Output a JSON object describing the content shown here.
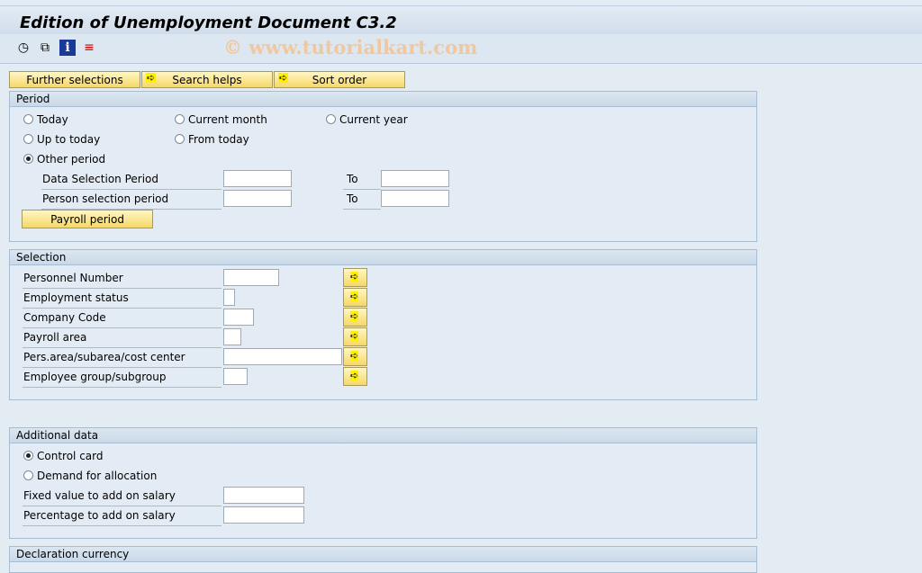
{
  "title": "Edition of Unemployment Document C3.2",
  "watermark": "© www.tutorialkart.com",
  "toolbar": {
    "icons": [
      "execute-clock-icon",
      "copy-icon",
      "info-icon",
      "selection-options-icon"
    ]
  },
  "buttons": {
    "further": "Further selections",
    "search": "Search helps",
    "sort": "Sort order"
  },
  "period": {
    "header": "Period",
    "radios": [
      {
        "label": "Today",
        "checked": false
      },
      {
        "label": "Current month",
        "checked": false
      },
      {
        "label": "Current year",
        "checked": false
      },
      {
        "label": "Up to today",
        "checked": false
      },
      {
        "label": "From today",
        "checked": false
      },
      {
        "label": "Other period",
        "checked": true
      }
    ],
    "data_sel": "Data Selection Period",
    "person_sel": "Person selection period",
    "to": "To",
    "payroll_btn": "Payroll period"
  },
  "selection": {
    "header": "Selection",
    "fields": [
      "Personnel Number",
      "Employment status",
      "Company Code",
      "Payroll area",
      "Pers.area/subarea/cost center",
      "Employee group/subgroup"
    ]
  },
  "additional": {
    "header": "Additional data",
    "radios": [
      {
        "label": "Control card",
        "checked": true
      },
      {
        "label": "Demand for allocation",
        "checked": false
      }
    ],
    "fixed": "Fixed value to add on salary",
    "percent": "Percentage to add on salary"
  },
  "currency": {
    "header": "Declaration currency"
  }
}
